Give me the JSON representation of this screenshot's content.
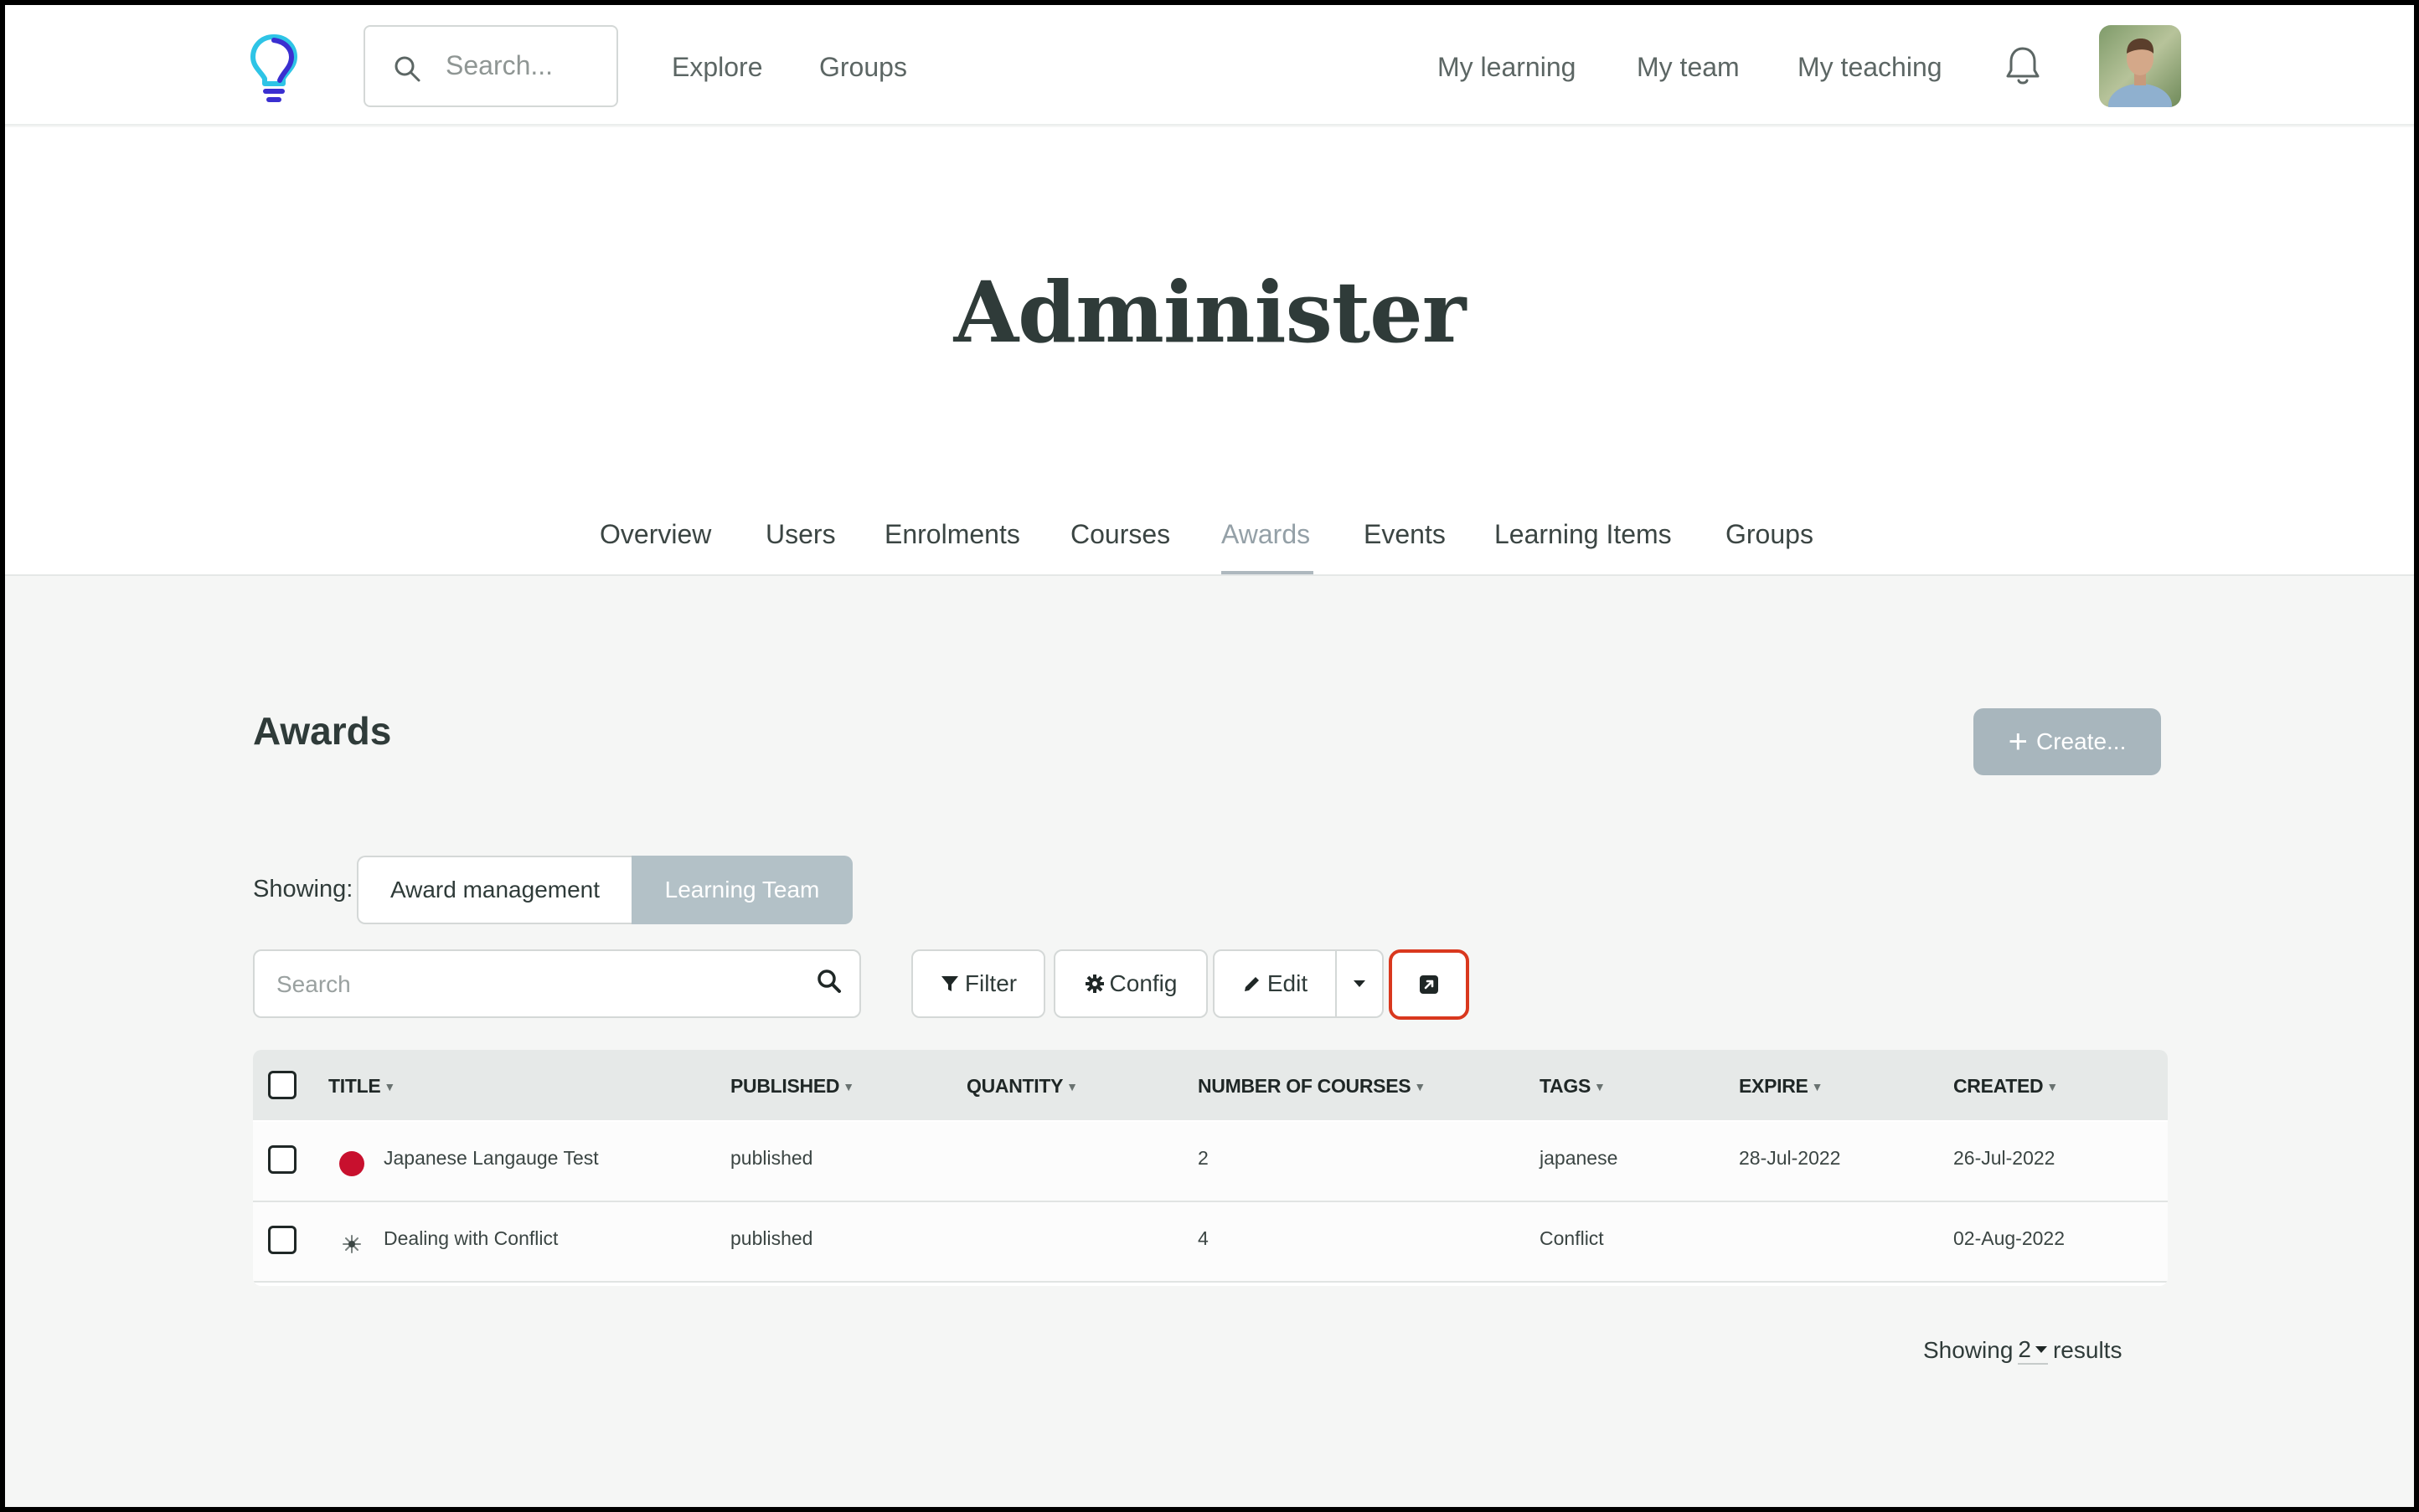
{
  "nav": {
    "search_placeholder": "Search...",
    "left_links": [
      "Explore",
      "Groups"
    ],
    "right_links": [
      "My learning",
      "My team",
      "My teaching"
    ],
    "icons": {
      "logo": "lightbulb-logo",
      "search": "search-icon",
      "notifications": "bell-icon",
      "avatar": "user-avatar"
    }
  },
  "hero": {
    "title": "Administer",
    "tabs": [
      "Overview",
      "Users",
      "Enrolments",
      "Courses",
      "Awards",
      "Events",
      "Learning Items",
      "Groups"
    ],
    "active_tab": "Awards"
  },
  "awards": {
    "title": "Awards",
    "create_label": "Create...",
    "showing_label": "Showing:",
    "segments": [
      "Award management",
      "Learning Team"
    ],
    "active_segment": "Learning Team",
    "search_placeholder": "Search",
    "toolbar": {
      "filter": "Filter",
      "config": "Config",
      "edit": "Edit"
    },
    "columns": [
      "TITLE",
      "PUBLISHED",
      "QUANTITY",
      "NUMBER OF COURSES",
      "TAGS",
      "EXPIRE",
      "CREATED"
    ],
    "rows": [
      {
        "icon": "japan-flag-icon",
        "title": "Japanese Langauge Test",
        "published": "published",
        "quantity": "",
        "courses": "2",
        "tags": "japanese",
        "expire": "28-Jul-2022",
        "created": "26-Jul-2022"
      },
      {
        "icon": "conflict-icon",
        "title": "Dealing with Conflict",
        "published": "published",
        "quantity": "",
        "courses": "4",
        "tags": "Conflict",
        "expire": "",
        "created": "02-Aug-2022"
      }
    ],
    "footer": {
      "prefix": "Showing",
      "count": "2",
      "suffix": "results"
    }
  },
  "colors": {
    "accent_disabled": "#a8b6bd",
    "highlight": "#d9381e",
    "active_tab": "#94a0a7",
    "logo_cyan": "#2ec4e6",
    "logo_blue": "#3a2fd0"
  }
}
